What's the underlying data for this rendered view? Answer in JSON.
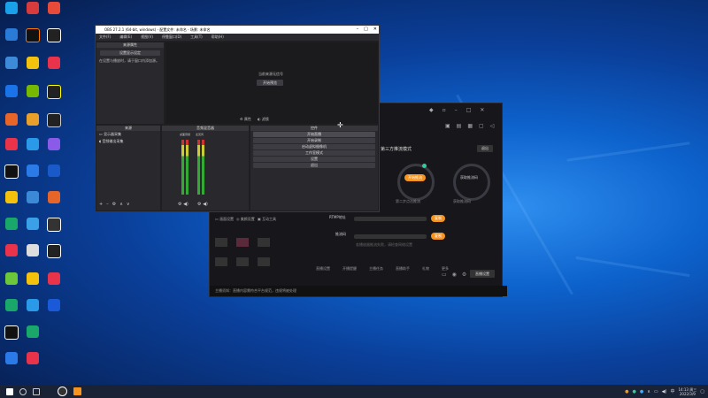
{
  "obs": {
    "title": "OBS 27.2.1 (64-bit, windows) - 配置文件: 未命名 - 场景: 未命名",
    "menu": [
      "文件(F)",
      "编辑(E)",
      "视图(V)",
      "停靠窗口(D)",
      "工具(T)",
      "帮助(H)"
    ],
    "top_dock_title": "来源属性",
    "top_dock_button": "设置显示设定",
    "top_dock_text": "在设置与播放时，请于窗口内添加源。",
    "preview_msg": "当前来源无信号",
    "preview_btn": "开始预览",
    "props_label": "属性",
    "filters_label": "滤镜",
    "scenes_title": "来源",
    "scenes": [
      "显示器采集",
      "音频输出采集"
    ],
    "mixer_title": "音频混音器",
    "mixer_channels": [
      "桌面音频",
      "麦克风"
    ],
    "controls_title": "控件",
    "controls": [
      "开始直播",
      "开始录制",
      "启动虚拟摄像机",
      "工作室模式",
      "设置",
      "退出"
    ]
  },
  "live": {
    "mode_text": "第三方推流模式",
    "exit_btn": "退出",
    "btn_start": "开始推流",
    "btn_get": "获取推流码",
    "circle_left_caption": "第二步点击推流",
    "circle_right_caption": "获取推流码",
    "rtmp_label": "RTMP地址",
    "code_label": "推流码",
    "copy1": "复制",
    "copy2": "复制",
    "hint": "若播放器推流失败，请检查网络设置",
    "tools": [
      "直播设置",
      "开播提醒",
      "主播任务",
      "直播助手",
      "礼物",
      "更多"
    ],
    "tools_right": "直播设置",
    "grid": [
      [
        "画面设置",
        "美颜设置",
        "互动工具"
      ],
      [
        "",
        "",
        ""
      ],
      [
        "",
        "",
        ""
      ]
    ],
    "footer": "主播须知：直播内容需符合平台规范，违规将被处理"
  },
  "taskbar": {
    "time": "14:13 周三",
    "date": "2022/3/9"
  },
  "colors": {
    "accent": "#f7941d"
  }
}
